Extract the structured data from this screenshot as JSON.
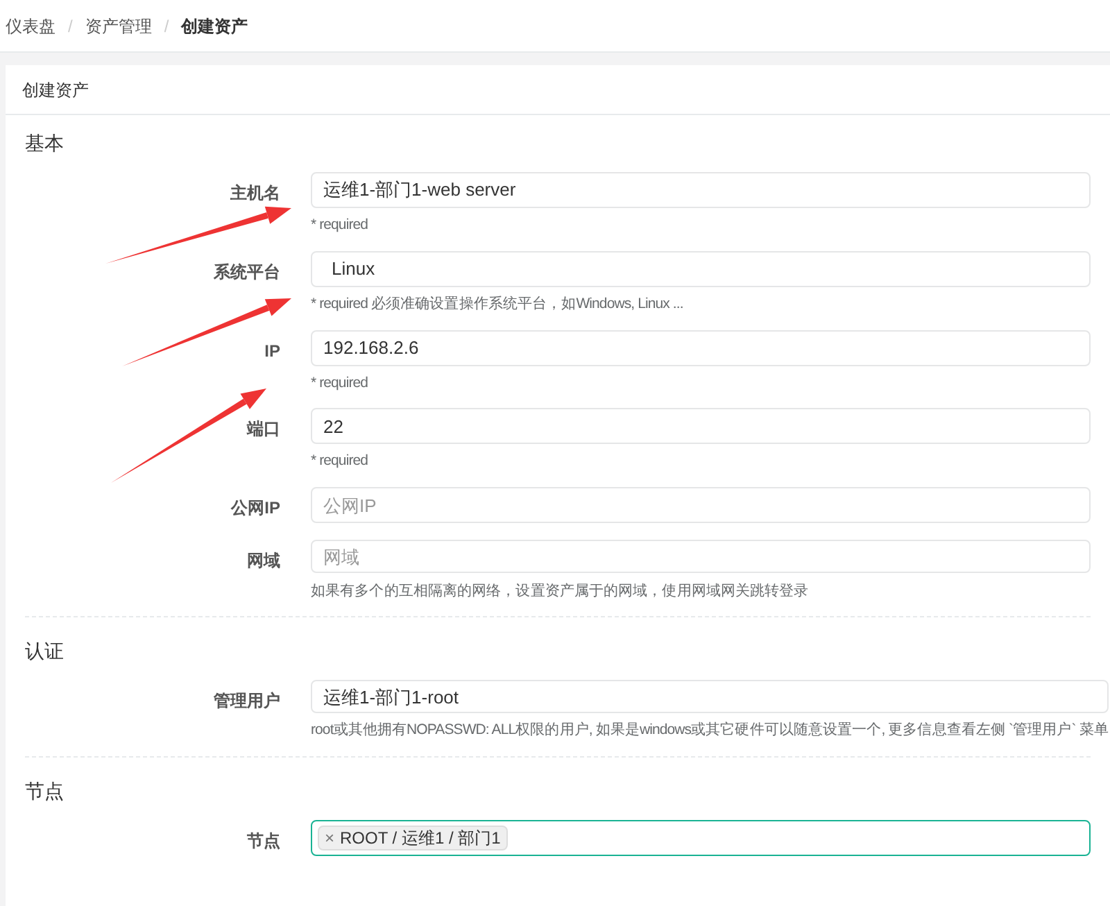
{
  "breadcrumb": [
    {
      "label": "仪表盘",
      "current": false,
      "separator": "/"
    },
    {
      "label": "资产管理",
      "current": false,
      "separator": "/"
    },
    {
      "label": "创建资产",
      "current": true
    }
  ],
  "panel": {
    "title": "创建资产"
  },
  "sections": [
    {
      "heading": "基本",
      "fields": [
        {
          "label": "主机名",
          "kind": "text",
          "value": "运维1-部门1-web server",
          "hint": "* required"
        },
        {
          "label": "系统平台",
          "kind": "select",
          "value": "Linux",
          "hint": "* required 必须准确设置操作系统平台，如Windows, Linux ..."
        },
        {
          "label": "IP",
          "kind": "text",
          "value": "192.168.2.6",
          "hint": "* required"
        },
        {
          "label": "端口",
          "kind": "text",
          "value": "22",
          "hint": "* required"
        },
        {
          "label": "公网IP",
          "kind": "text",
          "placeholder": "公网IP"
        },
        {
          "label": "网域",
          "kind": "text",
          "placeholder": "网域",
          "hint": "如果有多个的互相隔离的网络，设置资产属于的网域，使用网域网关跳转登录"
        }
      ]
    },
    {
      "heading": "认证",
      "fields": [
        {
          "label": "管理用户",
          "kind": "select",
          "value": "运维1-部门1-root",
          "hint": "root或其他拥有NOPASSWD: ALL权限的用户, 如果是windows或其它硬件可以随意设置一个, 更多信息查看左侧 `管理用户` 菜单"
        }
      ]
    },
    {
      "heading": "节点",
      "fields": [
        {
          "label": "节点",
          "kind": "tags",
          "tags": [
            {
              "remove": "×",
              "label": "ROOT / 运维1 / 部门1"
            }
          ]
        }
      ]
    }
  ]
}
